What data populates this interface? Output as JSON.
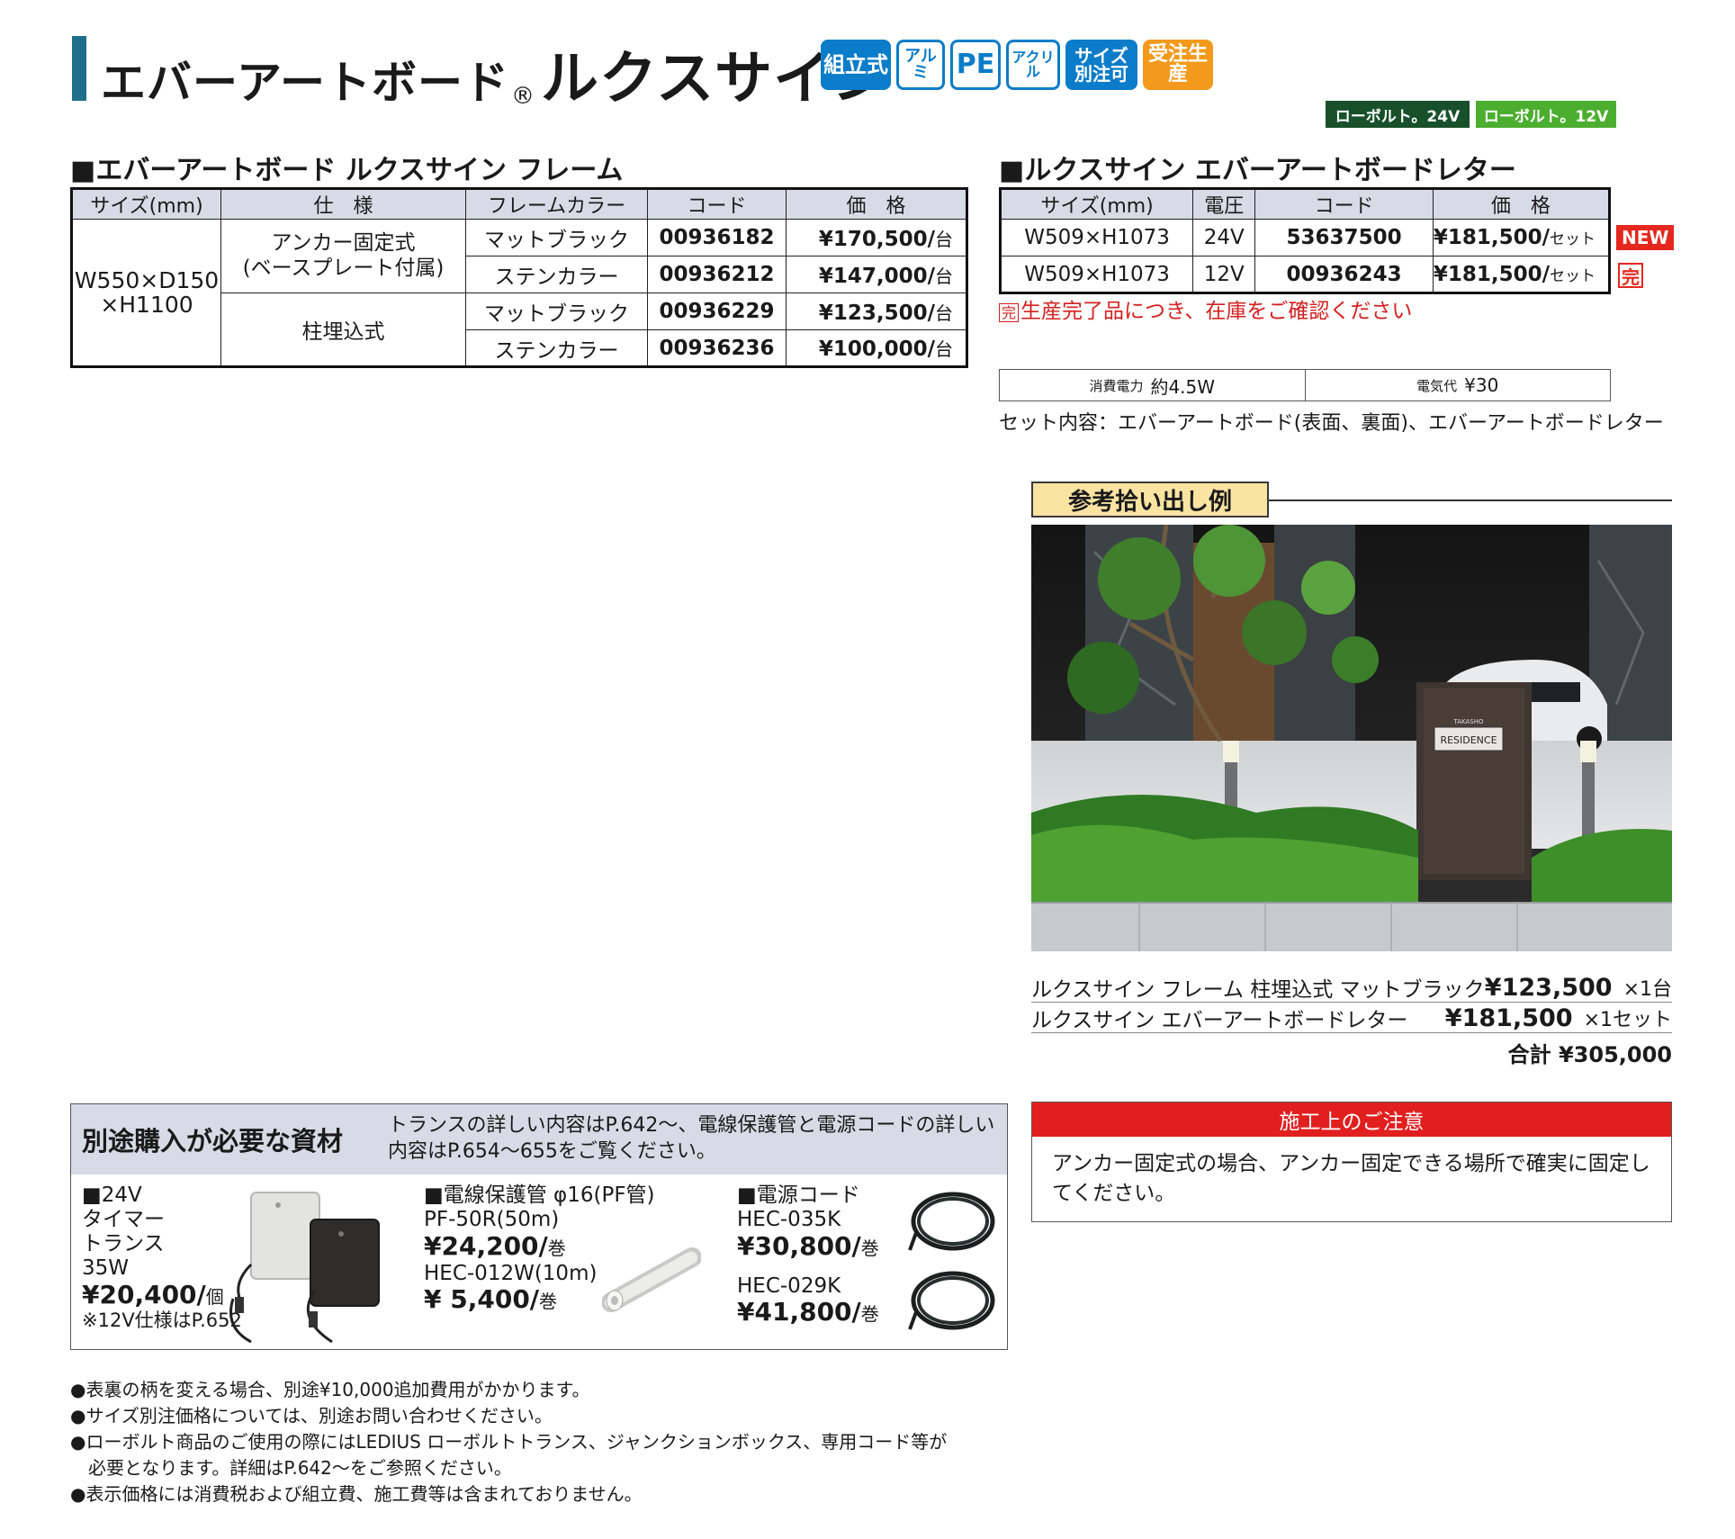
{
  "header": {
    "title_main": "エバーアートボード",
    "title_reg": "®",
    "title_sub": "ルクスサイン",
    "badges": [
      {
        "label": "組立式",
        "style": "blue"
      },
      {
        "label": "アルミ",
        "style": "outline"
      },
      {
        "label": "PE",
        "style": "outline"
      },
      {
        "label": "アクリル",
        "style": "outline"
      },
      {
        "label": "サイズ別注可",
        "style": "blue"
      },
      {
        "label": "受注生産",
        "style": "orange"
      }
    ],
    "voltage_tags": [
      {
        "label": "ローボルト。24V",
        "color": "#17502a"
      },
      {
        "label": "ローボルト。12V",
        "color": "#4cae2f"
      }
    ]
  },
  "frame_section": {
    "heading": "■エバーアートボード ルクスサイン フレーム",
    "columns": [
      "サイズ(mm)",
      "仕　様",
      "フレームカラー",
      "コード",
      "価　格"
    ],
    "size_line1": "W550×D150",
    "size_line2": "×H1100",
    "spec_anchor_line1": "アンカー固定式",
    "spec_anchor_line2": "(ベースプレート付属)",
    "spec_buried": "柱埋込式",
    "rows": [
      {
        "color": "マットブラック",
        "code": "00936182",
        "price": "¥170,500/",
        "unit": "台"
      },
      {
        "color": "ステンカラー",
        "code": "00936212",
        "price": "¥147,000/",
        "unit": "台"
      },
      {
        "color": "マットブラック",
        "code": "00936229",
        "price": "¥123,500/",
        "unit": "台"
      },
      {
        "color": "ステンカラー",
        "code": "00936236",
        "price": "¥100,000/",
        "unit": "台"
      }
    ]
  },
  "letter_section": {
    "heading": "■ルクスサイン エバーアートボードレター",
    "columns": [
      "サイズ(mm)",
      "電圧",
      "コード",
      "価　格"
    ],
    "rows": [
      {
        "size": "W509×H1073",
        "voltage": "24V",
        "code": "53637500",
        "price": "¥181,500/",
        "unit": "セット"
      },
      {
        "size": "W509×H1073",
        "voltage": "12V",
        "code": "00936243",
        "price": "¥181,500/",
        "unit": "セット"
      }
    ],
    "new_badge": "NEW",
    "kan_badge": "完",
    "discontinued_mark": "完",
    "discontinued_note": "生産完了品につき、在庫をご確認ください",
    "power_label": "消費電力",
    "power_value": "約4.5W",
    "cost_label": "電気代",
    "cost_value": "¥30",
    "set_content": "セット内容：エバーアートボード(表面、裏面)、エバーアートボードレター"
  },
  "example": {
    "label": "参考拾い出し例",
    "sign_small": "TAKASHO",
    "sign_text": "RESIDENCE",
    "items": [
      {
        "name": "ルクスサイン フレーム 柱埋込式 マットブラック",
        "price": "¥123,500",
        "qty": "×1台"
      },
      {
        "name": "ルクスサイン エバーアートボードレター",
        "price": "¥181,500",
        "qty": "×1セット"
      }
    ],
    "total": "合計 ¥305,000"
  },
  "caution": {
    "title": "施工上のご注意",
    "text": "アンカー固定式の場合、アンカー固定できる場所で確実に固定してください。"
  },
  "materials": {
    "title": "別途購入が必要な資材",
    "desc_line1": "トランスの詳しい内容はP.642〜、電線保護管と電源コードの詳しい",
    "desc_line2": "内容はP.654〜655をご覧ください。",
    "transformer": {
      "l1": "■24V",
      "l2": "タイマー",
      "l3": "トランス",
      "l4": "35W",
      "price": "¥20,400/",
      "unit": "個",
      "note": "※12V仕様はP.652"
    },
    "conduit": {
      "title": "■電線保護管 φ16(PF管)",
      "model1": "PF-50R(50m)",
      "price1": "¥24,200/",
      "unit1": "巻",
      "model2": "HEC-012W(10m)",
      "price2": "¥ 5,400/",
      "unit2": "巻"
    },
    "cord": {
      "title": "■電源コード",
      "model1": "HEC-035K",
      "price1": "¥30,800/",
      "unit1": "巻",
      "model2": "HEC-029K",
      "price2": "¥41,800/",
      "unit2": "巻"
    }
  },
  "notes": [
    "●表裏の柄を変える場合、別途¥10,000追加費用がかかります。",
    "●サイズ別注価格については、別途お問い合わせください。",
    "●ローボルト商品のご使用の際にはLEDIUS ローボルトトランス、ジャンクションボックス、専用コード等が",
    "　必要となります。詳細はP.642〜をご参照ください。",
    "●表示価格には消費税および組立費、施工費等は含まれておりません。"
  ]
}
